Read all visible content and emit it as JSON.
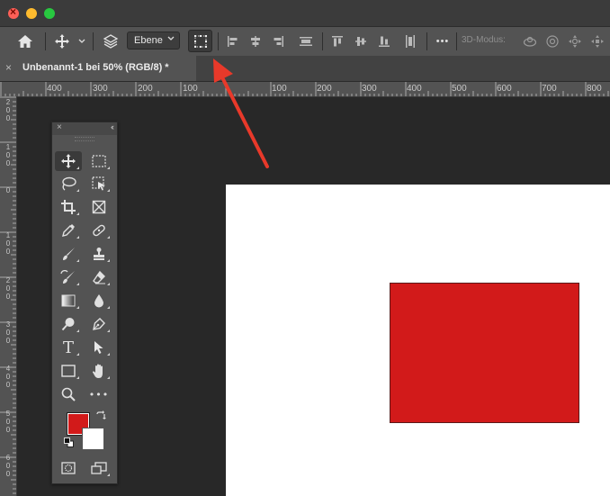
{
  "window": {
    "traffic_lights": [
      "close",
      "minimize",
      "maximize"
    ]
  },
  "options_bar": {
    "layer_dropdown": "Ebene",
    "mode_label": "3D-Modus:",
    "more_label": "•••"
  },
  "document": {
    "tab_title": "Unbenannt-1 bei 50% (RGB/8) *",
    "tab_close": "×"
  },
  "ruler": {
    "top_labels": [
      "400",
      "300",
      "200",
      "100",
      "100",
      "200",
      "300",
      "400",
      "500",
      "600",
      "700",
      "800"
    ],
    "left_labels": [
      "200",
      "100",
      "0",
      "100",
      "200",
      "300",
      "400",
      "500",
      "600"
    ]
  },
  "toolbox": {
    "close": "×",
    "collapse": "‹‹",
    "type_tool_glyph": "T",
    "more_tools_glyph": "•••",
    "foreground_color": "#d21a1a",
    "background_color": "#ffffff"
  },
  "canvas": {
    "background": "#ffffff",
    "shape_color": "#d21a1a"
  },
  "annotation": {
    "arrow_color": "#e8392a"
  }
}
